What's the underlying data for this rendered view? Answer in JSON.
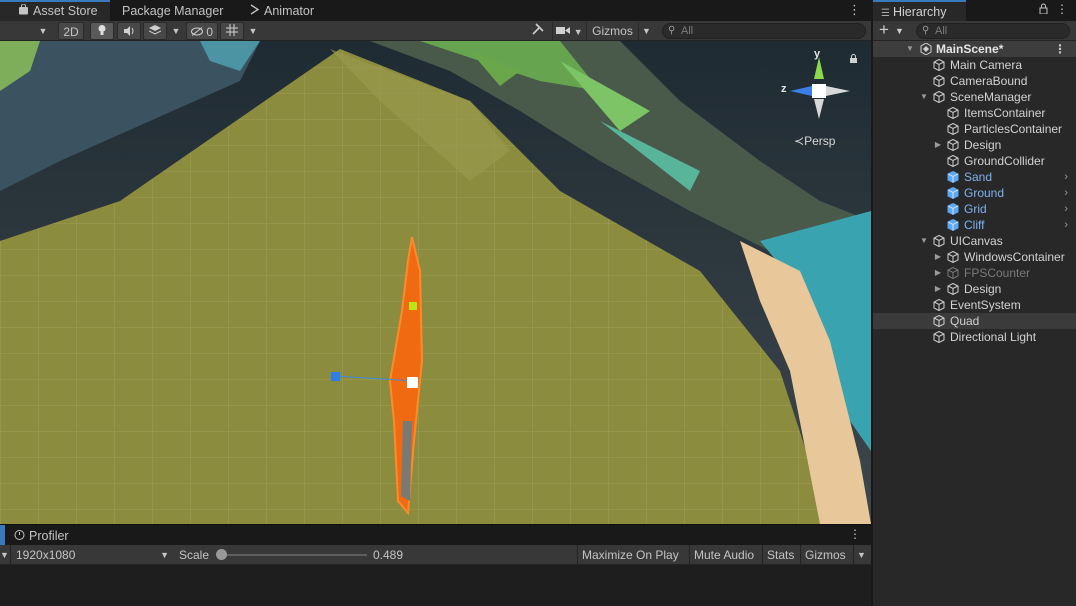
{
  "scene_tabs": {
    "asset_store": "Asset Store",
    "package_manager": "Package Manager",
    "animator": "Animator"
  },
  "scene_toolbar": {
    "mode_2d": "2D",
    "hidden_count": "0",
    "gizmos": "Gizmos",
    "search_placeholder": "All"
  },
  "scene_view": {
    "projection": "Persp",
    "axes": {
      "y": "y",
      "z": "z"
    }
  },
  "game": {
    "tab": "Profiler",
    "resolution": "1920x1080",
    "scale_label": "Scale",
    "scale_value": "0.489",
    "scale_fraction": 0.02,
    "maximize_on_play": "Maximize On Play",
    "mute_audio": "Mute Audio",
    "stats": "Stats",
    "gizmos": "Gizmos"
  },
  "hierarchy": {
    "title": "Hierarchy",
    "search_placeholder": "All",
    "scene": "MainScene*",
    "items": [
      {
        "label": "Main Camera",
        "depth": 1,
        "expander": "none",
        "type": "normal"
      },
      {
        "label": "CameraBound",
        "depth": 1,
        "expander": "none",
        "type": "normal"
      },
      {
        "label": "SceneManager",
        "depth": 1,
        "expander": "open",
        "type": "normal"
      },
      {
        "label": "ItemsContainer",
        "depth": 2,
        "expander": "none",
        "type": "normal"
      },
      {
        "label": "ParticlesContainer",
        "depth": 2,
        "expander": "none",
        "type": "normal"
      },
      {
        "label": "Design",
        "depth": 2,
        "expander": "closed",
        "type": "normal"
      },
      {
        "label": "GroundCollider",
        "depth": 2,
        "expander": "none",
        "type": "normal"
      },
      {
        "label": "Sand",
        "depth": 2,
        "expander": "none",
        "type": "prefab"
      },
      {
        "label": "Ground",
        "depth": 2,
        "expander": "none",
        "type": "prefab"
      },
      {
        "label": "Grid",
        "depth": 2,
        "expander": "none",
        "type": "prefab"
      },
      {
        "label": "Cliff",
        "depth": 2,
        "expander": "none",
        "type": "prefab"
      },
      {
        "label": "UICanvas",
        "depth": 1,
        "expander": "open",
        "type": "normal"
      },
      {
        "label": "WindowsContainer",
        "depth": 2,
        "expander": "closed",
        "type": "normal"
      },
      {
        "label": "FPSCounter",
        "depth": 2,
        "expander": "closed",
        "type": "disabled"
      },
      {
        "label": "Design",
        "depth": 2,
        "expander": "closed",
        "type": "normal"
      },
      {
        "label": "EventSystem",
        "depth": 1,
        "expander": "none",
        "type": "normal"
      },
      {
        "label": "Quad",
        "depth": 1,
        "expander": "none",
        "type": "normal",
        "selected": true
      },
      {
        "label": "Directional Light",
        "depth": 1,
        "expander": "none",
        "type": "normal"
      }
    ]
  },
  "colors": {
    "accent": "#3a79bb",
    "prefab_text": "#7cb2ee",
    "ground": "#8c8c3e",
    "selection_outline": "#f06a12"
  }
}
